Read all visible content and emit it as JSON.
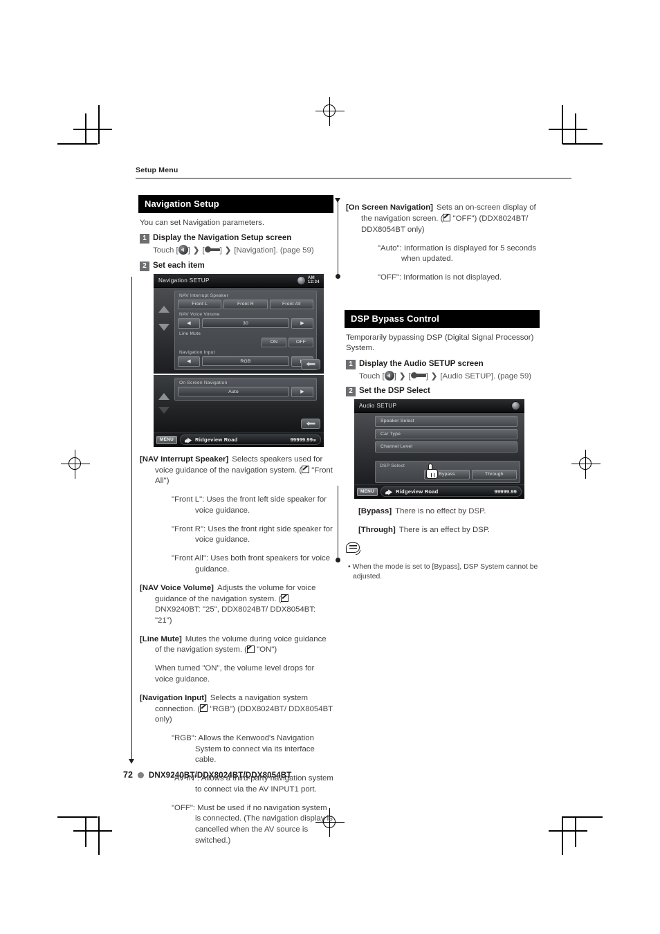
{
  "running_head": "Setup Menu",
  "footer": {
    "page_number": "72",
    "models": "DNX9240BT/DDX8024BT/DDX8054BT"
  },
  "left_column": {
    "section": {
      "title": "Navigation Setup",
      "intro": "You can set Navigation parameters.",
      "steps": [
        {
          "num": "1",
          "title": "Display the Navigation Setup screen",
          "touch_prefix": "Touch [",
          "touch_mid": "] ",
          "touch_target": "] ▶ [Navigation]. (page 59)",
          "target_label": "[Navigation]. (page 59)"
        },
        {
          "num": "2",
          "title": "Set each item"
        }
      ]
    },
    "device_screen": {
      "title": "Navigation SETUP",
      "clock_ampm": "AM",
      "clock_time": "12:34",
      "groups": [
        {
          "label": "NAV Interrupt Speaker",
          "buttons": [
            "Front L",
            "Front R",
            "Front All"
          ]
        },
        {
          "label": "NAV Voice Volume",
          "value": "30"
        },
        {
          "label": "Line Mute",
          "buttons": [
            "ON",
            "OFF"
          ]
        },
        {
          "label": "Navigation Input",
          "value": "RGB"
        },
        {
          "label": "On Screen Navigation",
          "value": "Auto"
        }
      ],
      "statusbar": {
        "menu": "MENU",
        "route": "Ridgeview Road",
        "distance": "99999.99",
        "distance_unit": "m"
      }
    },
    "definitions": [
      {
        "term": "[NAV Interrupt Speaker]",
        "desc": "Selects speakers used for voice guidance of the navigation system. (",
        "default": "\"Front All\")",
        "sub": [
          "\"Front L\": Uses the front left side speaker for voice guidance.",
          "\"Front R\": Uses the front right side speaker for voice guidance.",
          "\"Front All\": Uses both front speakers for voice guidance."
        ]
      },
      {
        "term": "[NAV Voice Volume]",
        "desc": "Adjusts the volume for voice guidance of the navigation system. (",
        "default": "DNX9240BT: \"25\", DDX8024BT/ DDX8054BT: \"21\")",
        "sub": []
      },
      {
        "term": "[Line Mute]",
        "desc": "Mutes the volume during voice guidance of the navigation system. (",
        "default": "\"ON\")",
        "extra": "When turned \"ON\", the volume level drops for voice guidance.",
        "sub": []
      },
      {
        "term": "[Navigation Input]",
        "desc": "Selects a navigation system connection. (",
        "default": "\"RGB\") (DDX8024BT/ DDX8054BT only)",
        "sub": [
          "\"RGB\": Allows the Kenwood's Navigation System to connect via its interface cable.",
          "\"AV-IN\": Allows a third-party navigation system to connect via the AV INPUT1 port.",
          "\"OFF\": Must be used if no navigation system is connected. (The navigation display is cancelled when the AV source is switched.)"
        ]
      }
    ]
  },
  "right_column": {
    "on_screen_nav": {
      "term": "[On Screen Navigation]",
      "desc": "Sets an on-screen display of the navigation screen. (",
      "default": "\"OFF\") (DDX8024BT/ DDX8054BT only)",
      "sub": [
        "\"Auto\": Information is displayed for 5 seconds when updated.",
        "\"OFF\": Information is not displayed."
      ]
    },
    "section": {
      "title": "DSP Bypass Control",
      "intro": "Temporarily bypassing DSP (Digital Signal Processor) System.",
      "steps": [
        {
          "num": "1",
          "title": "Display the Audio SETUP screen",
          "touch_prefix": "Touch [",
          "target_label": "[Audio SETUP]. (page 59)"
        },
        {
          "num": "2",
          "title": "Set the DSP Select"
        }
      ]
    },
    "device_screen": {
      "title": "Audio SETUP",
      "list_items": [
        "Speaker Select",
        "Car Type",
        "Channel Level"
      ],
      "dsp_label": "DSP Select",
      "dsp_buttons": [
        "Bypass",
        "Through"
      ],
      "statusbar": {
        "menu": "MENU",
        "route": "Ridgeview Road",
        "distance": "99999.99"
      }
    },
    "definitions": [
      {
        "term": "[Bypass]",
        "desc": "There is no effect by DSP."
      },
      {
        "term": "[Through]",
        "desc": "There is an effect by DSP."
      }
    ],
    "note": {
      "items": [
        "When the mode is set to [Bypass], DSP System cannot be adjusted."
      ]
    }
  }
}
